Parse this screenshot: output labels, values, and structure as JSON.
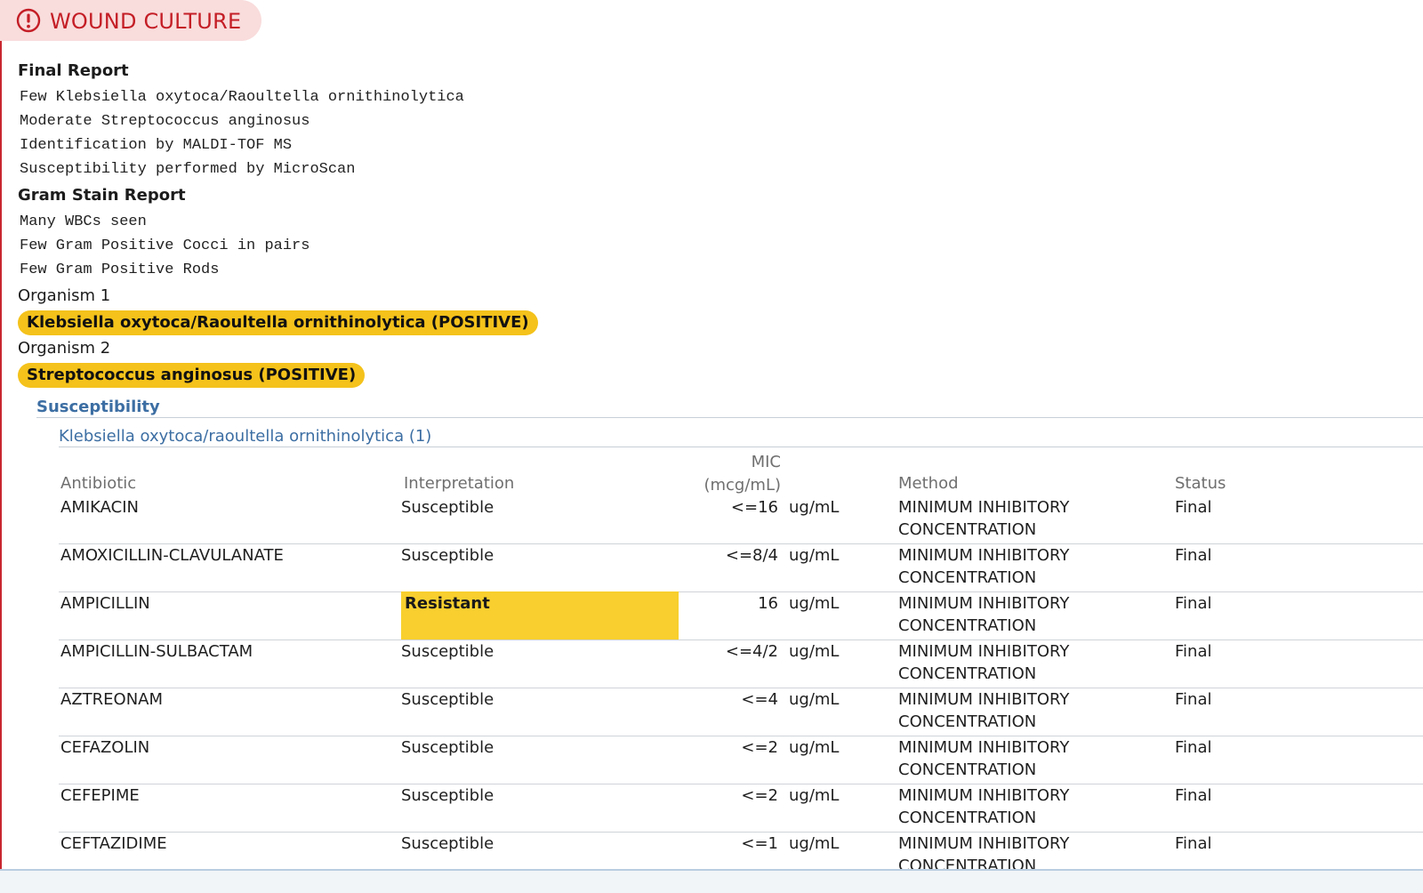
{
  "header": {
    "title": "WOUND CULTURE",
    "icon": "alert-circle-icon",
    "accent": "#c41e26",
    "band": "#f9dcdc"
  },
  "final_report": {
    "label": "Final Report",
    "lines": [
      "Few Klebsiella oxytoca/Raoultella ornithinolytica",
      "Moderate Streptococcus anginosus",
      "Identification by MALDI-TOF MS",
      "Susceptibility performed by MicroScan"
    ]
  },
  "gram_stain": {
    "label": "Gram Stain Report",
    "lines": [
      "Many WBCs seen",
      "Few Gram Positive Cocci in pairs",
      "Few Gram Positive Rods"
    ]
  },
  "organisms": [
    {
      "label": "Organism 1",
      "name": "Klebsiella oxytoca/Raoultella ornithinolytica (POSITIVE)"
    },
    {
      "label": "Organism 2",
      "name": "Streptococcus anginosus (POSITIVE)"
    }
  ],
  "highlight_color": "#f4c21b",
  "susceptibility": {
    "title": "Susceptibility",
    "organism_title": "Klebsiella oxytoca/raoultella ornithinolytica (1)",
    "columns": {
      "antibiotic": "Antibiotic",
      "interpretation": "Interpretation",
      "mic_line1": "MIC",
      "mic_line2": "(mcg/mL)",
      "method": "Method",
      "status": "Status"
    },
    "rows": [
      {
        "antibiotic": "AMIKACIN",
        "interpretation": "Susceptible",
        "mic": "<=16",
        "unit": "ug/mL",
        "method": "MINIMUM INHIBITORY CONCENTRATION",
        "status": "Final"
      },
      {
        "antibiotic": "AMOXICILLIN-CLAVULANATE",
        "interpretation": "Susceptible",
        "mic": "<=8/4",
        "unit": "ug/mL",
        "method": "MINIMUM INHIBITORY CONCENTRATION",
        "status": "Final"
      },
      {
        "antibiotic": "AMPICILLIN",
        "interpretation": "Resistant",
        "mic": "16",
        "unit": "ug/mL",
        "method": "MINIMUM INHIBITORY CONCENTRATION",
        "status": "Final"
      },
      {
        "antibiotic": "AMPICILLIN-SULBACTAM",
        "interpretation": "Susceptible",
        "mic": "<=4/2",
        "unit": "ug/mL",
        "method": "MINIMUM INHIBITORY CONCENTRATION",
        "status": "Final"
      },
      {
        "antibiotic": "AZTREONAM",
        "interpretation": "Susceptible",
        "mic": "<=4",
        "unit": "ug/mL",
        "method": "MINIMUM INHIBITORY CONCENTRATION",
        "status": "Final"
      },
      {
        "antibiotic": "CEFAZOLIN",
        "interpretation": "Susceptible",
        "mic": "<=2",
        "unit": "ug/mL",
        "method": "MINIMUM INHIBITORY CONCENTRATION",
        "status": "Final"
      },
      {
        "antibiotic": "CEFEPIME",
        "interpretation": "Susceptible",
        "mic": "<=2",
        "unit": "ug/mL",
        "method": "MINIMUM INHIBITORY CONCENTRATION",
        "status": "Final"
      },
      {
        "antibiotic": "CEFTAZIDIME",
        "interpretation": "Susceptible",
        "mic": "<=1",
        "unit": "ug/mL",
        "method": "MINIMUM INHIBITORY CONCENTRATION",
        "status": "Final"
      }
    ]
  }
}
